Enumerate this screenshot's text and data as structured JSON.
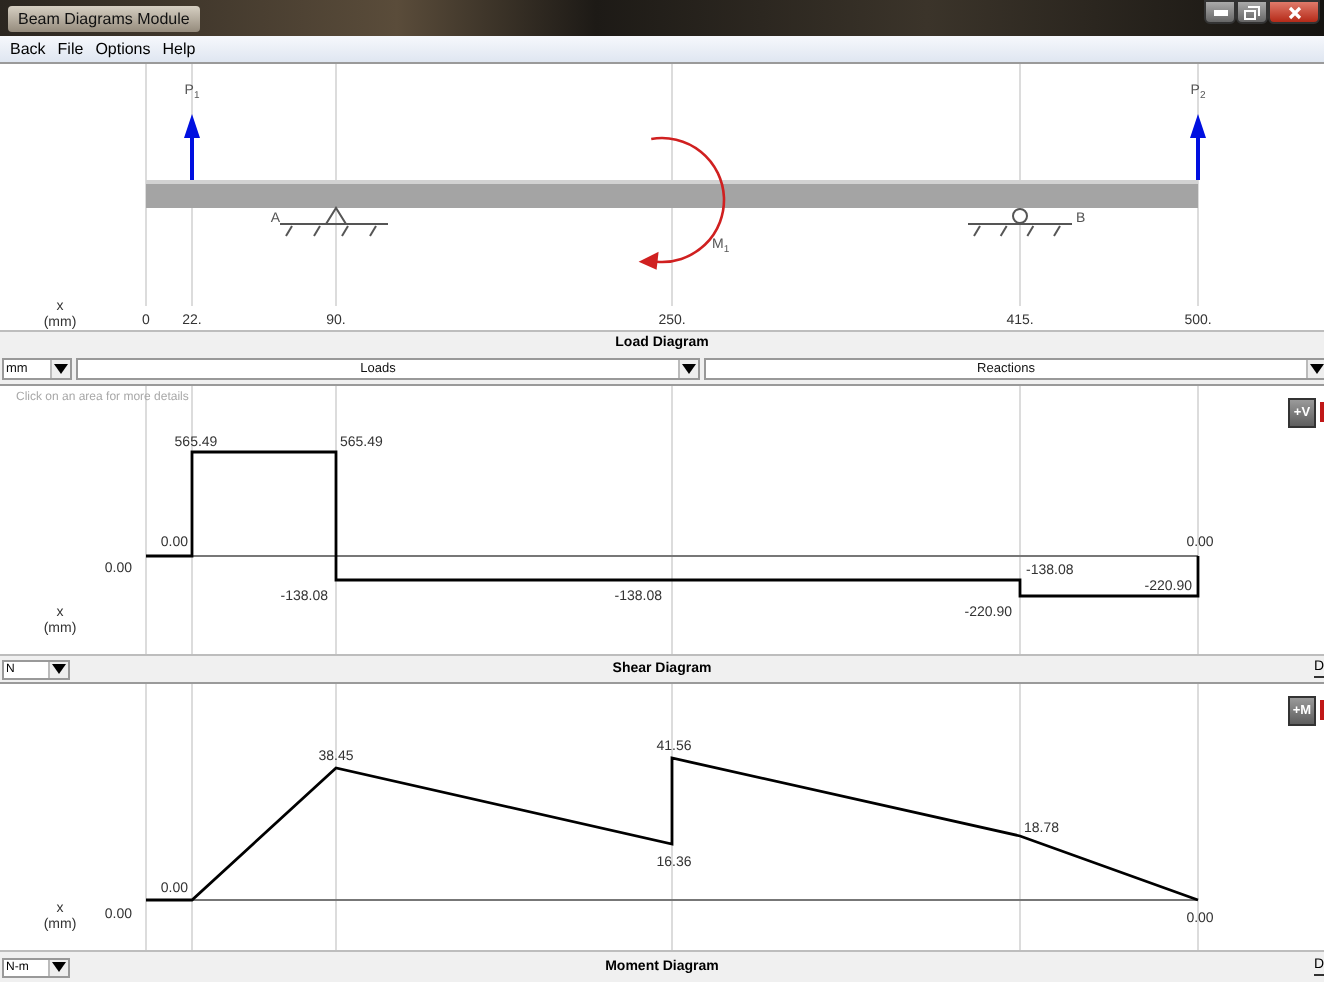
{
  "window": {
    "title": "Beam Diagrams Module"
  },
  "menu": [
    {
      "label": "Back"
    },
    {
      "label": "File"
    },
    {
      "label": "Options"
    },
    {
      "label": "Help"
    }
  ],
  "load_diagram": {
    "x_label": "x",
    "x_unit": "(mm)",
    "caption": "Load Diagram",
    "ticks": [
      {
        "label": "0"
      },
      {
        "label": "22.",
        "marks": [
          {
            "kind": "force",
            "symbol": "P",
            "subscript": "1"
          }
        ]
      },
      {
        "label": "90.",
        "marks": [
          {
            "kind": "pin",
            "symbol": "A"
          }
        ]
      },
      {
        "label": "250.",
        "marks": [
          {
            "kind": "moment",
            "symbol": "M",
            "subscript": "1"
          }
        ]
      },
      {
        "label": "415.",
        "marks": [
          {
            "kind": "roller",
            "symbol": "B"
          }
        ]
      },
      {
        "label": "500.",
        "marks": [
          {
            "kind": "force",
            "symbol": "P",
            "subscript": "2"
          }
        ]
      }
    ]
  },
  "controls": {
    "unit": "mm",
    "loads": "Loads",
    "reactions": "Reactions"
  },
  "shear_diagram": {
    "hint": "Click on an area for more details",
    "toggle": "+V",
    "x_label": "x",
    "x_unit": "(mm)",
    "value_labels": [
      "0.00",
      "0.00",
      "565.49",
      "565.49",
      "-138.08",
      "-138.08",
      "-138.08",
      "-220.90",
      "-220.90",
      "0.00"
    ],
    "caption": "Shear Diagram",
    "unit": "N",
    "side_button": "D"
  },
  "moment_diagram": {
    "toggle": "+M",
    "x_label": "x",
    "x_unit": "(mm)",
    "value_labels": [
      "0.00",
      "0.00",
      "38.45",
      "16.36",
      "41.56",
      "18.78",
      "0.00"
    ],
    "caption": "Moment Diagram",
    "unit": "N-m",
    "side_button": "D"
  }
}
